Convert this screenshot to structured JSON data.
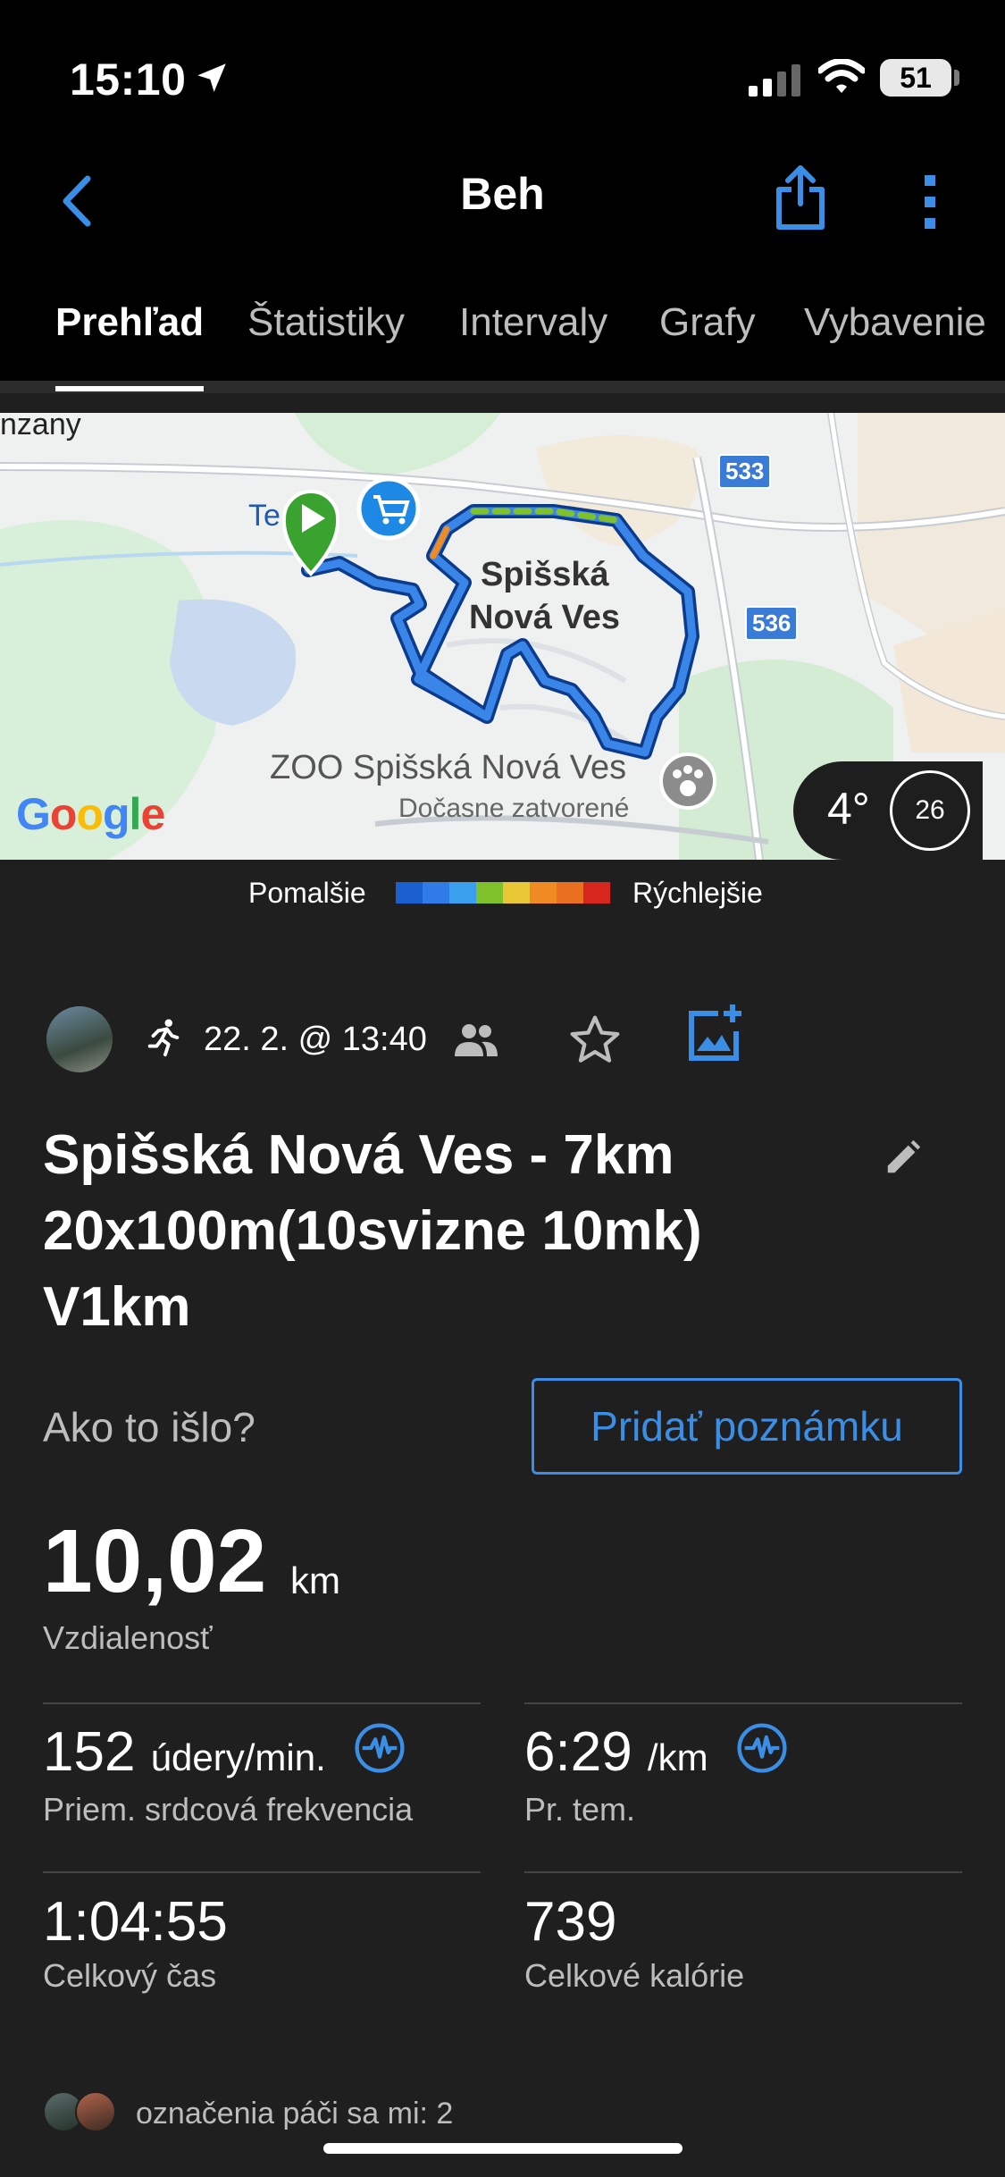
{
  "status_bar": {
    "time": "15:10",
    "battery": "51"
  },
  "nav": {
    "title": "Beh"
  },
  "tabs": [
    "Prehľad",
    "Štatistiky",
    "Intervaly",
    "Grafy",
    "Vybavenie"
  ],
  "map": {
    "label_partial": "nzany",
    "label_te": "Te",
    "city_line1": "Spišská",
    "city_line2": "Nová Ves",
    "road1": "533",
    "road2": "536",
    "zoo_name": "ZOO Spišská Nová Ves",
    "zoo_status": "Dočasne zatvorené",
    "google": "Google",
    "weather_temp": "4°",
    "wind_speed": "26"
  },
  "legend": {
    "slower": "Pomalšie",
    "faster": "Rýchlejšie",
    "colors": [
      "#1a5fd0",
      "#2f7be8",
      "#3aa0ee",
      "#7fc12b",
      "#e8c737",
      "#ef8b22",
      "#ea6f20",
      "#d7261e"
    ]
  },
  "meta": {
    "date": "22. 2. @ 13:40"
  },
  "activity": {
    "title_line1": "Spišská Nová Ves - 7km",
    "title_line2": "20x100m(10svizne 10mk)",
    "title_line3": "V1km",
    "how_was_it": "Ako to išlo?",
    "add_note": "Pridať poznámku"
  },
  "distance": {
    "value": "10,02",
    "unit": "km",
    "label": "Vzdialenosť"
  },
  "stats": {
    "hr": {
      "value": "152",
      "unit": "údery/min.",
      "label": "Priem. srdcová frekvencia"
    },
    "pace": {
      "value": "6:29",
      "unit": "/km",
      "label": "Pr. tem."
    },
    "time": {
      "value": "1:04:55",
      "label": "Celkový čas"
    },
    "calories": {
      "value": "739",
      "label": "Celkové kalórie"
    }
  },
  "likes": {
    "text": "označenia páči sa mi: 2"
  },
  "colors": {
    "accent": "#3a8ee6",
    "background": "#1f1f1f",
    "bar": "#000000"
  }
}
